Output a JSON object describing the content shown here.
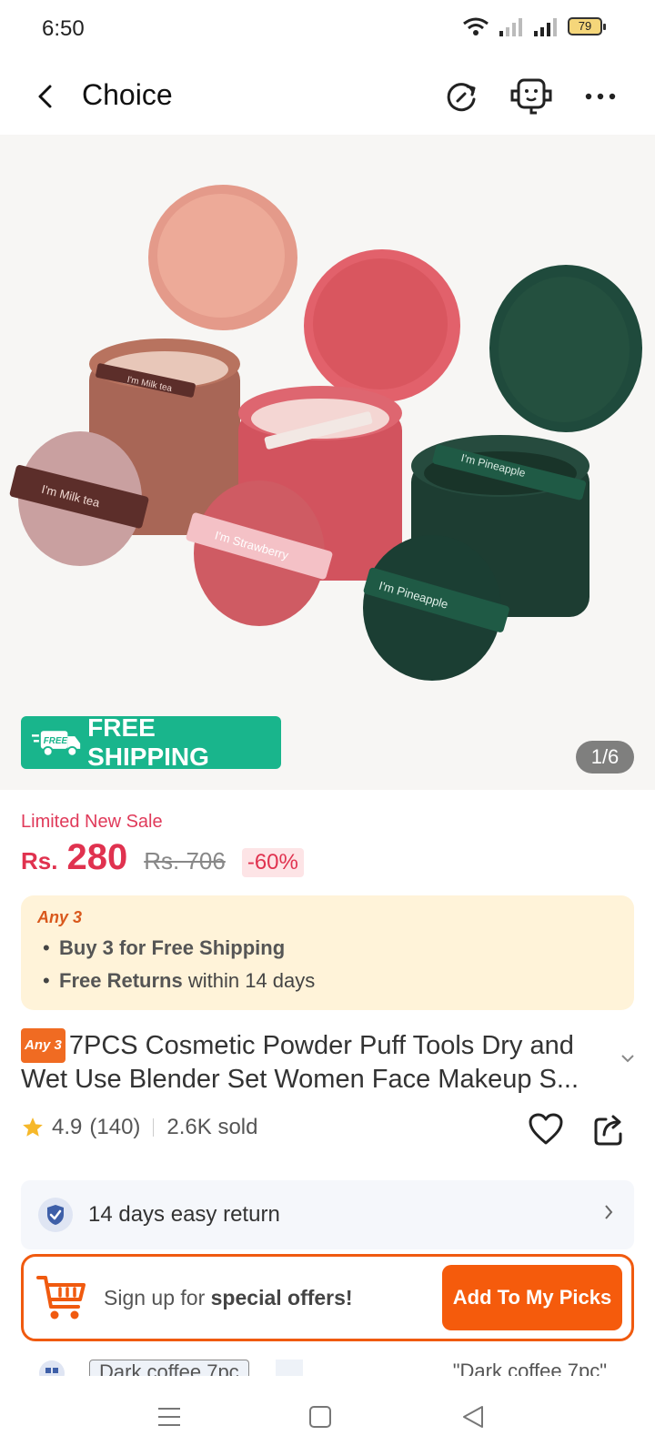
{
  "status": {
    "time": "6:50",
    "battery": "79"
  },
  "nav": {
    "title": "Choice"
  },
  "hero": {
    "free_shipping_badge": "FREE",
    "free_shipping": "FREE SHIPPING",
    "counter": "1/6",
    "labels": [
      "I'm Milk tea",
      "I'm Milk tea",
      "I'm Strawberry",
      "I'm Pineapple",
      "I'm Pineapple"
    ]
  },
  "price": {
    "sale_label": "Limited New Sale",
    "currency": "Rs.",
    "value": "280",
    "old": "Rs. 706",
    "discount": "-60%"
  },
  "promo": {
    "tag": "Any 3",
    "line1_bold": "Buy 3 for  Free Shipping",
    "line2_bold": "Free Returns",
    "line2_rest": " within 14 days"
  },
  "product": {
    "badge": "Any 3",
    "title": "7PCS Cosmetic Powder Puff Tools Dry and Wet Use Blender Set Women Face Makeup S..."
  },
  "rating": {
    "score": "4.9",
    "count": "(140)",
    "sold": "2.6K sold"
  },
  "return": {
    "label": "14 days easy return"
  },
  "signup": {
    "text_plain": "Sign up for ",
    "text_bold": "special offers!",
    "button": "Add To My Picks"
  },
  "variant": {
    "chip": "Dark coffee 7pc",
    "quote": "\"Dark coffee 7pc\""
  }
}
